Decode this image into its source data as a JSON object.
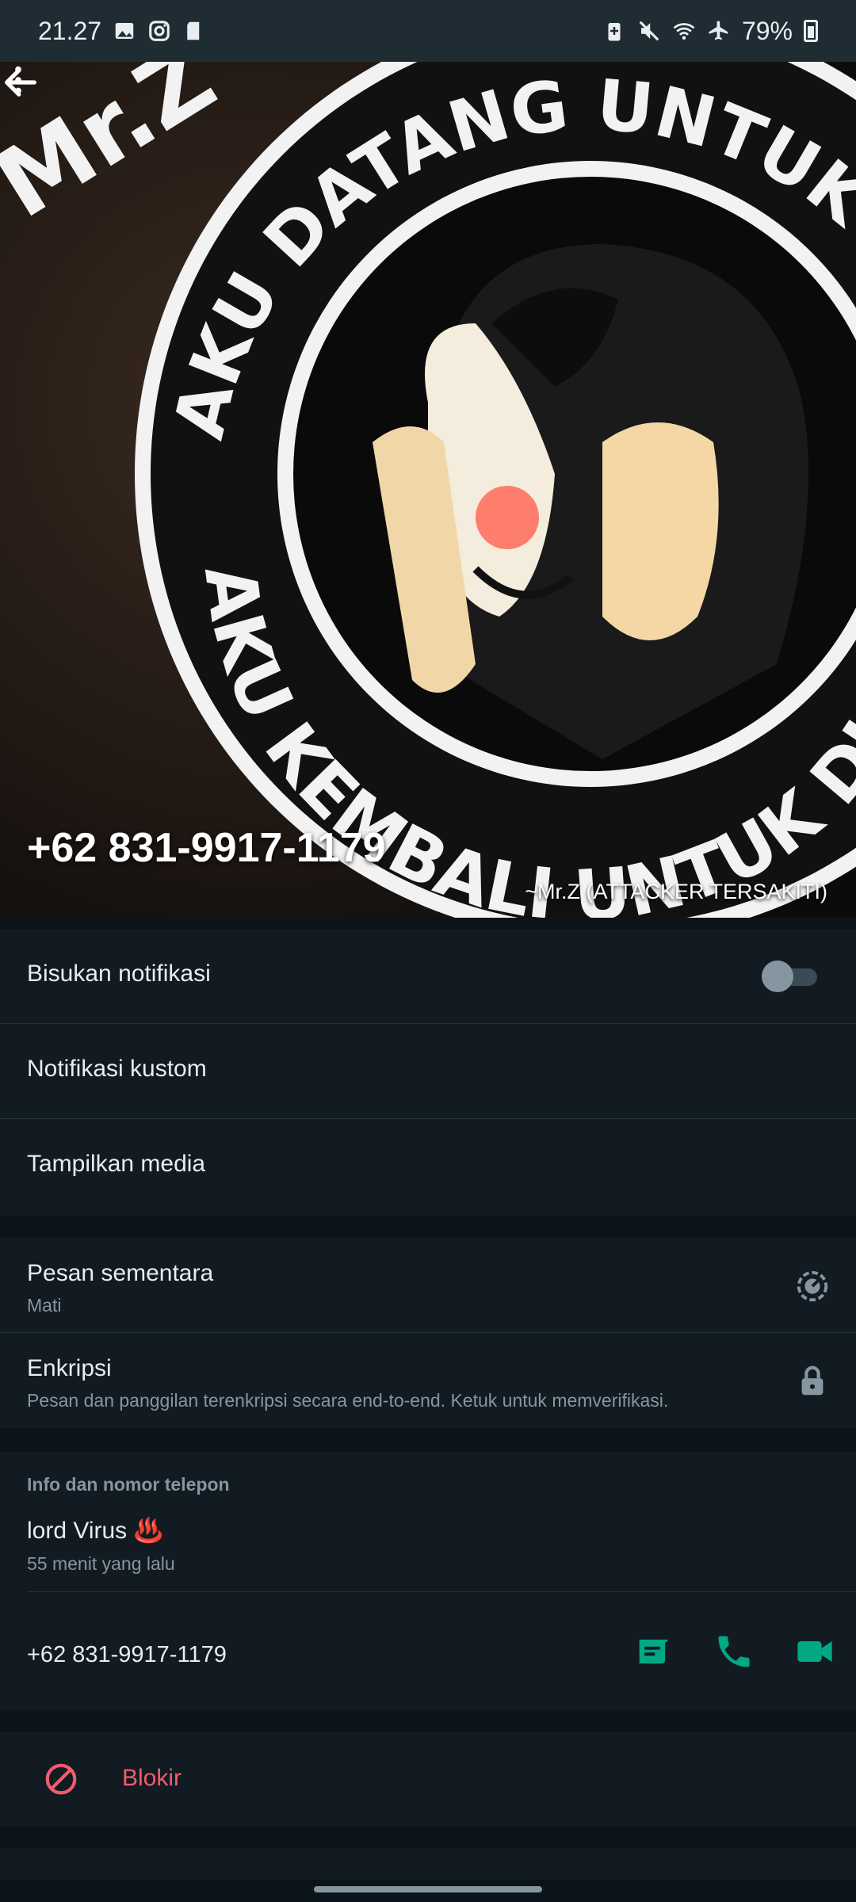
{
  "status_bar": {
    "time": "21.27",
    "battery": "79%"
  },
  "header": {
    "phone": "+62 831-9917-1179",
    "credit": "~Mr.Z (ATTACKER TERSAKITI)",
    "photo_text_top": "AKU DATANG UNTUK DISINI",
    "photo_text_bottom": "AKU KEMBALI UNTUK DISINI",
    "photo_logo": "Mr.Z"
  },
  "settings": {
    "mute_label": "Bisukan notifikasi",
    "mute_on": false,
    "custom_label": "Notifikasi kustom",
    "media_label": "Tampilkan media",
    "disappearing_title": "Pesan sementara",
    "disappearing_sub": "Mati",
    "encryption_title": "Enkripsi",
    "encryption_sub": "Pesan dan panggilan terenkripsi secara end-to-end. Ketuk untuk memverifikasi."
  },
  "info": {
    "heading": "Info dan nomor telepon",
    "about": "lord Virus ♨️",
    "about_time": "55 menit yang lalu",
    "phone": "+62 831-9917-1179"
  },
  "block": {
    "label": "Blokir"
  },
  "colors": {
    "accent": "#00a884",
    "danger": "#f15c6d",
    "background": "#0b141a",
    "panel": "#111b21"
  },
  "icons": [
    "back-arrow-icon",
    "more-vert-icon",
    "timer-icon",
    "lock-icon",
    "message-icon",
    "phone-icon",
    "video-icon",
    "block-icon"
  ]
}
